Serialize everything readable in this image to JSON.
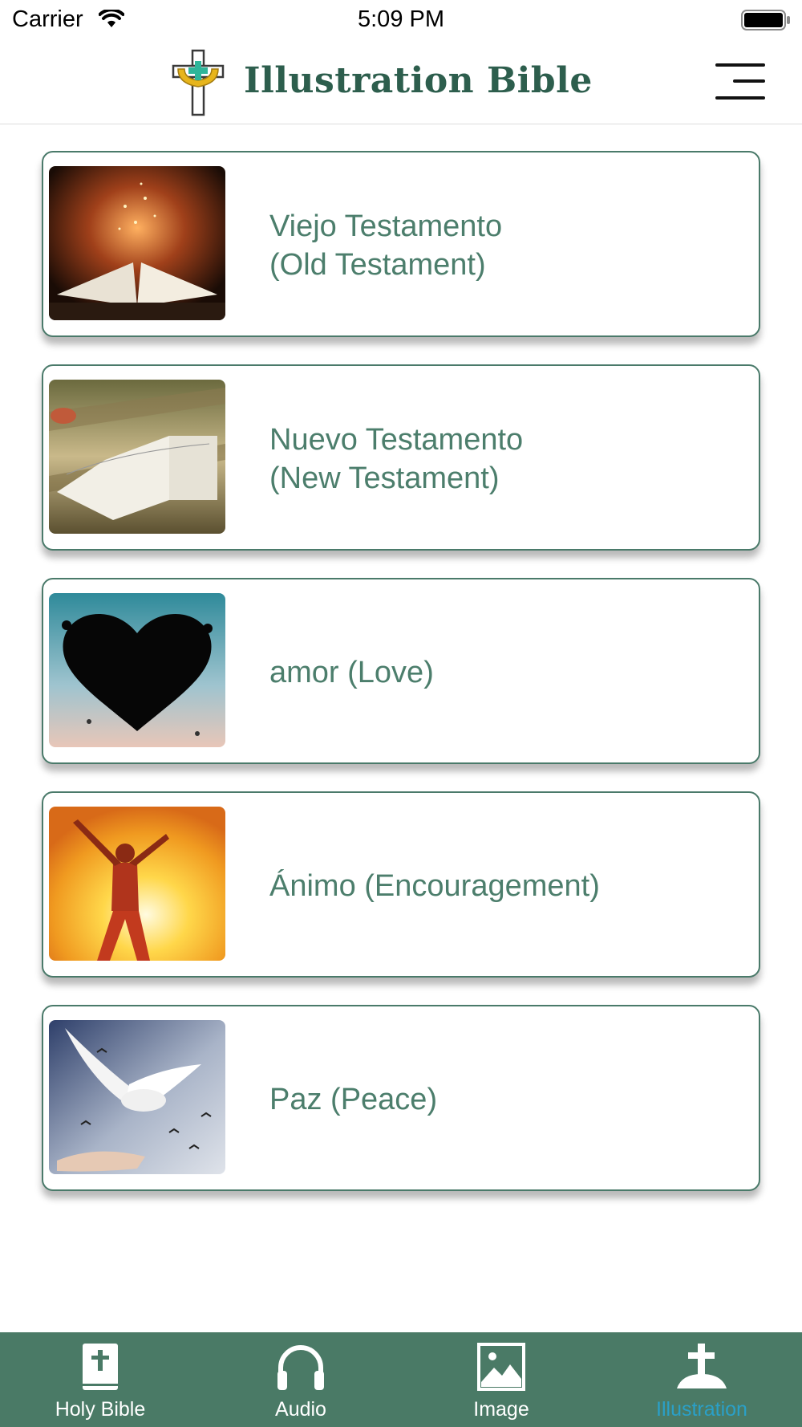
{
  "status_bar": {
    "carrier": "Carrier",
    "time": "5:09 PM"
  },
  "header": {
    "title": "Illustration Bible",
    "logo_icon": "cross-logo-icon",
    "menu_icon": "hamburger-menu-icon"
  },
  "cards": [
    {
      "label": "Viejo Testamento\n (Old Testament)",
      "image": "glowing-open-bible-photo"
    },
    {
      "label": "Nuevo Testamento\n (New Testament)",
      "image": "open-bible-on-table-photo"
    },
    {
      "label": "amor (Love)",
      "image": "heart-tree-photo"
    },
    {
      "label": "Ánimo (Encouragement)",
      "image": "man-arms-raised-sunset-photo"
    },
    {
      "label": "Paz (Peace)",
      "image": "dove-birds-hands-photo"
    }
  ],
  "tabs": [
    {
      "label": "Holy Bible",
      "icon": "bible-book-icon",
      "active": false
    },
    {
      "label": "Audio",
      "icon": "headphones-icon",
      "active": false
    },
    {
      "label": "Image",
      "icon": "picture-icon",
      "active": false
    },
    {
      "label": "Illustration",
      "icon": "cross-hill-icon",
      "active": true
    }
  ],
  "colors": {
    "brand_green": "#4a7a66",
    "text_green": "#4c7e6c",
    "active_tab": "#2aa0c8"
  }
}
